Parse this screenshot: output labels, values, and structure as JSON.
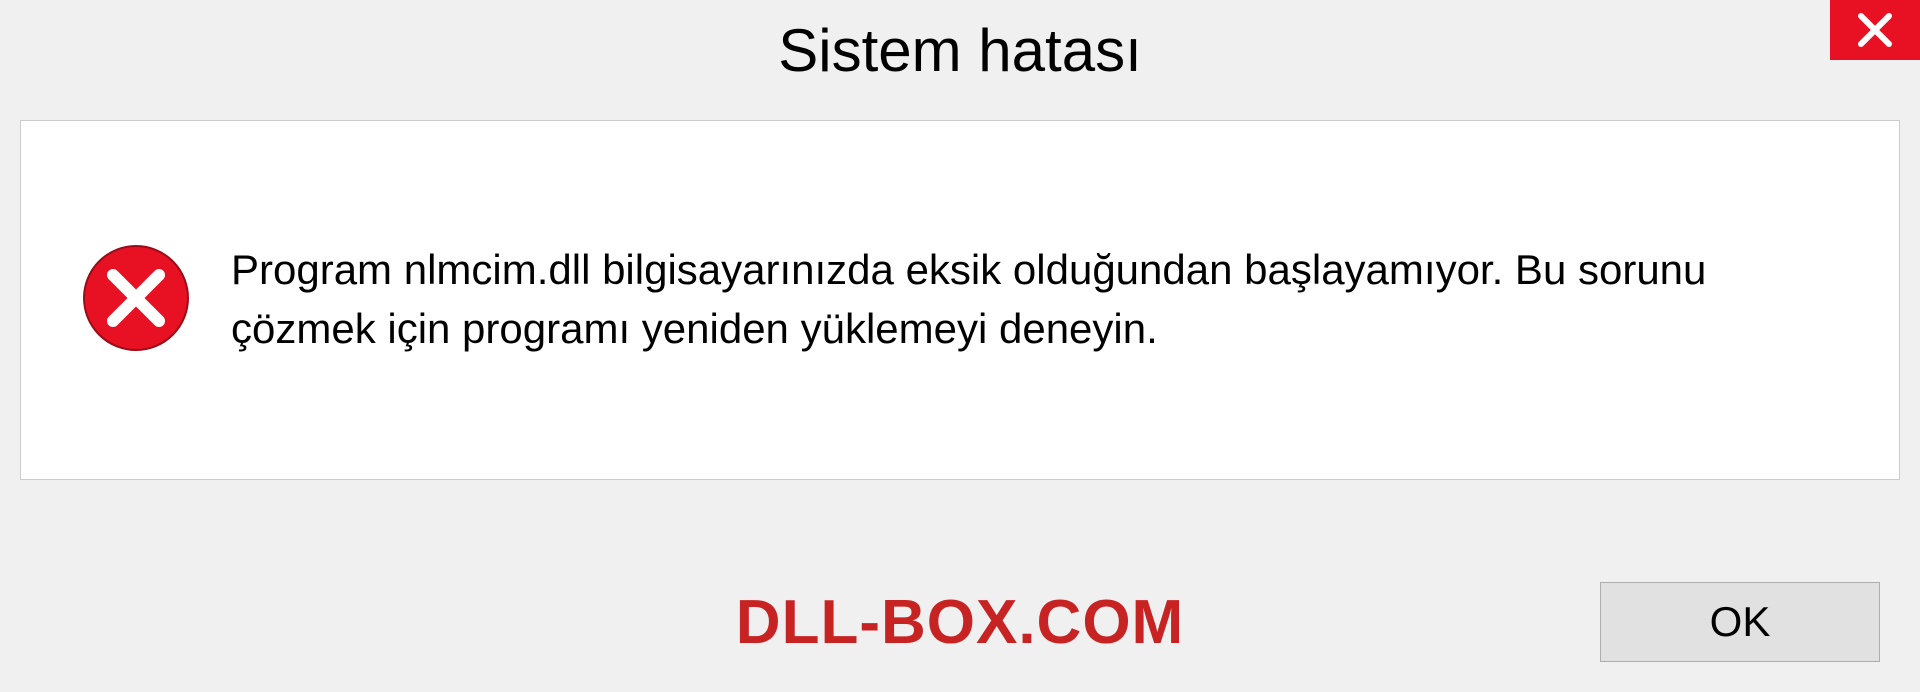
{
  "dialog": {
    "title": "Sistem hatası",
    "message": "Program nlmcim.dll bilgisayarınızda eksik olduğundan başlayamıyor. Bu sorunu çözmek için programı yeniden yüklemeyi deneyin.",
    "ok_label": "OK"
  },
  "watermark": "DLL-BOX.COM"
}
